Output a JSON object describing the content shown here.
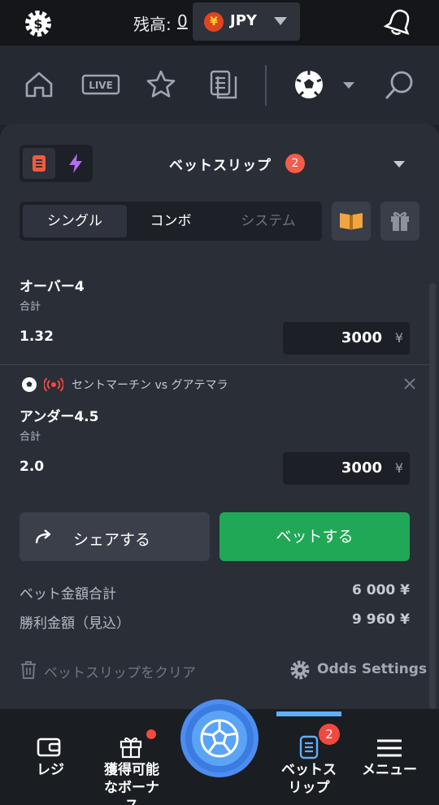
{
  "header": {
    "balance_label": "残高:",
    "balance_value": "0",
    "currency_code": "JPY",
    "currency_symbol": "¥"
  },
  "nav": {
    "live_label": "LIVE"
  },
  "bet_slip": {
    "title": "ベットスリップ",
    "count": "2",
    "tabs": [
      "シングル",
      "コンボ",
      "システム"
    ],
    "active_tab": "シングル",
    "bets": [
      {
        "match": "",
        "selection": "オーバー4",
        "total_label": "合計",
        "odds": "1.32",
        "stake": "3000",
        "stake_currency": "¥"
      },
      {
        "match": "セントマーチン vs グアテマラ",
        "selection": "アンダー4.5",
        "total_label": "合計",
        "odds": "2.0",
        "stake": "3000",
        "stake_currency": "¥"
      }
    ],
    "share_label": "シェアする",
    "bet_label": "ベットする",
    "summary": {
      "total_stake_label": "ベット金額合計",
      "total_stake_value": "6 000 ¥",
      "potential_win_label": "勝利金額（見込）",
      "potential_win_value": "9 960 ¥"
    },
    "clear_label": "ベットスリップをクリア",
    "odds_settings_label": "Odds Settings"
  },
  "bottom_nav": {
    "items": [
      {
        "label": "レジ"
      },
      {
        "label": "獲得可能なボーナス"
      },
      {
        "label": "ベットスリップ",
        "badge": "2"
      },
      {
        "label": "メニュー"
      }
    ]
  },
  "colors": {
    "accent_green": "#21a857",
    "badge_red": "#f45c4b",
    "active_blue": "#5fb0f8"
  }
}
